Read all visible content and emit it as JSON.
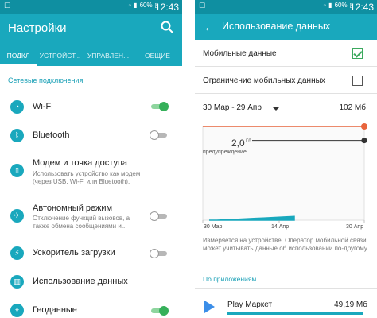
{
  "status_bar": {
    "time": "12:43",
    "battery": "60%"
  },
  "settings": {
    "title": "Настройки",
    "tabs": [
      "ПОДКЛЮЧЕНИЯ",
      "УСТРОЙСТВО",
      "УПРАВЛЕНИЕ",
      "ОБЩИЕ"
    ],
    "tabs_visible": [
      "ПОДКЛ",
      "УСТРОЙСТ...",
      "УПРАВЛЕН...",
      "ОБЩИЕ"
    ],
    "active_tab": 0,
    "section": "Сетевые подключения",
    "items": [
      {
        "label": "Wi-Fi",
        "icon": "wifi-icon",
        "toggle": true,
        "on": true
      },
      {
        "label": "Bluetooth",
        "icon": "bluetooth-icon",
        "toggle": true,
        "on": false
      },
      {
        "label": "Модем и точка доступа",
        "subtitle": [
          "Использовать устройство как модем",
          "(через USB, Wi-Fi или Bluetooth)."
        ],
        "icon": "hotspot-icon",
        "toggle": false
      },
      {
        "label": "Автономный режим",
        "subtitle": [
          "Отключение функций вызовов, а",
          "также обмена сообщениями и..."
        ],
        "icon": "airplane-icon",
        "toggle": true,
        "on": false
      },
      {
        "label": "Ускоритель загрузки",
        "icon": "download-booster-icon",
        "toggle": true,
        "on": false
      },
      {
        "label": "Использование данных",
        "icon": "data-usage-icon",
        "toggle": false
      },
      {
        "label": "Геоданные",
        "icon": "location-icon",
        "toggle": true,
        "on": true
      }
    ]
  },
  "data_usage": {
    "title": "Использование данных",
    "mobile_data": {
      "label": "Мобильные данные",
      "checked": true
    },
    "limit_mobile": {
      "label": "Ограничение мобильных данных",
      "checked": false
    },
    "period": "30 Мар - 29 Апр",
    "total": "102 Мб",
    "warning_value": "2,0",
    "warning_unit": "Гб",
    "warning_label": "предупреждение",
    "note": "Измеряется на устройстве. Оператор мобильной связи может учитывать данные об использовании по-другому.",
    "by_apps": "По приложениям",
    "apps": [
      {
        "name": "Play Маркет",
        "size": "49,19 Мб"
      }
    ]
  },
  "chart_data": {
    "type": "area",
    "x_labels": [
      "30 Мар",
      "14 Апр",
      "30 Апр"
    ],
    "warning_level_gb": 2.0,
    "series": [
      {
        "values": [
          0,
          0,
          0.01,
          0.02,
          0.03,
          0.04,
          0.05,
          0.06,
          0.07,
          0.08,
          0.09,
          0.1
        ]
      }
    ],
    "colors": {
      "usage": "#19a8bd",
      "limit": "#e8643c",
      "warning": "#333333"
    }
  },
  "colors": {
    "accent": "#19a8bd",
    "status_bar": "#0f8fa1",
    "toggle_on": "#36b05a"
  }
}
